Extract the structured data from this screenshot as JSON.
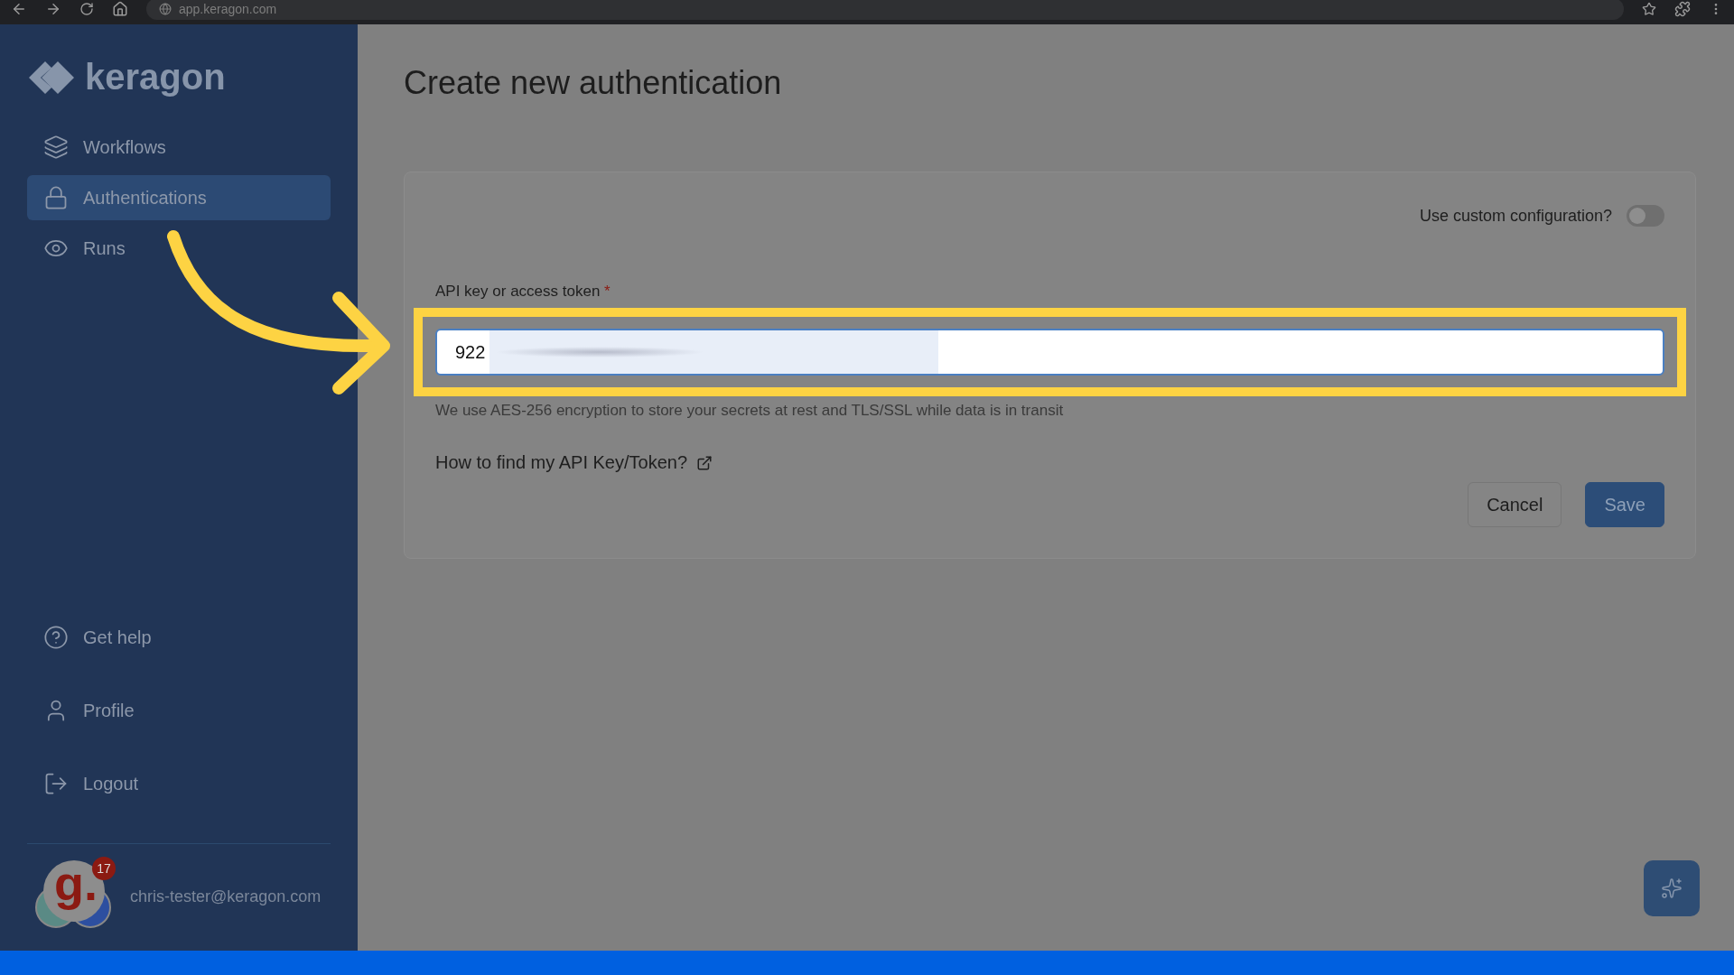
{
  "browser": {
    "url": "app.keragon.com"
  },
  "sidebar": {
    "logo": "keragon",
    "items": [
      {
        "label": "Workflows",
        "selected": false
      },
      {
        "label": "Authentications",
        "selected": true
      },
      {
        "label": "Runs",
        "selected": false
      }
    ],
    "bottom_items": [
      {
        "label": "Get help"
      },
      {
        "label": "Profile"
      },
      {
        "label": "Logout"
      }
    ],
    "user": {
      "email": "chris-tester@keragon.com",
      "notification_count": "17",
      "avatar_letter": "g."
    }
  },
  "page": {
    "title": "Create new authentication"
  },
  "form": {
    "custom_config": {
      "label": "Use custom configuration?",
      "on": false
    },
    "field": {
      "label": "API key or access token",
      "required_mark": "*",
      "value": "922"
    },
    "helper": "We use AES-256 encryption to store your secrets at rest and TLS/SSL while data is in transit",
    "link": "How to find my API Key/Token?",
    "buttons": [
      {
        "label": "Cancel",
        "kind": "secondary"
      },
      {
        "label": "Save",
        "kind": "primary"
      }
    ]
  }
}
